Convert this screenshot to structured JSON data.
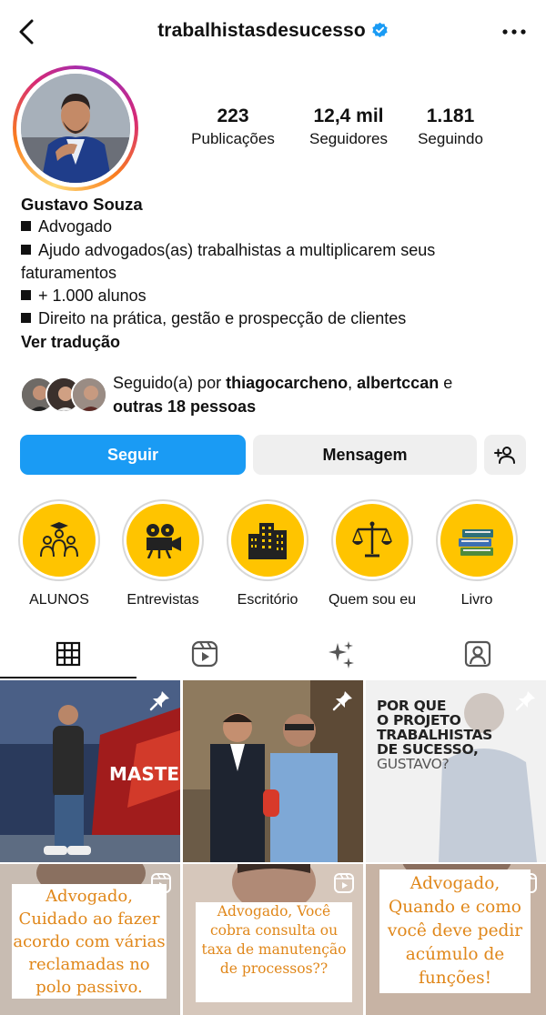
{
  "header": {
    "back_icon": "chevron-left-icon",
    "username": "trabalhistasdesucesso",
    "verified_icon": "verified-badge-icon",
    "more_icon": "more-horizontal-icon"
  },
  "stats": [
    {
      "value": "223",
      "label": "Publicações"
    },
    {
      "value": "12,4 mil",
      "label": "Seguidores"
    },
    {
      "value": "1.181",
      "label": "Seguindo"
    }
  ],
  "bio": {
    "name": "Gustavo Souza",
    "lines": [
      "Advogado",
      "Ajudo advogados(as) trabalhistas a multiplicarem seus faturamentos",
      "+ 1.000 alunos",
      "Direito na prática, gestão e prospecção de clientes"
    ],
    "translate": "Ver tradução"
  },
  "followed_by": {
    "prefix": "Seguido(a) por",
    "user1": "thiagocarcheno",
    "separator": ",",
    "user2": "albertccan",
    "conjunction": "e",
    "others": "outras 18 pessoas"
  },
  "actions": {
    "follow": "Seguir",
    "message": "Mensagem",
    "add_icon": "person-add-icon"
  },
  "highlights": [
    {
      "label": "ALUNOS",
      "icon": "graduates-icon"
    },
    {
      "label": "Entrevistas",
      "icon": "film-camera-icon"
    },
    {
      "label": "Escritório",
      "icon": "buildings-icon"
    },
    {
      "label": "Quem sou eu",
      "icon": "scales-icon"
    },
    {
      "label": "Livro",
      "icon": "books-icon"
    }
  ],
  "tabs": [
    "grid-icon",
    "reels-icon",
    "sparkles-icon",
    "tagged-icon"
  ],
  "posts": {
    "p1": {
      "banner": "MASTER MIND SA"
    },
    "p3": {
      "line1": "POR QUE",
      "line2": "O PROJETO",
      "line3": "TRABALHISTAS",
      "line4": "DE SUCESSO,",
      "line5": "GUSTAVO?"
    },
    "p4": {
      "text": "Advogado, Cuidado ao fazer acordo com várias reclamadas no polo passivo."
    },
    "p5": {
      "text": "Advogado, Você cobra consulta ou taxa de manutenção de processos??"
    },
    "p6": {
      "text": "Advogado, Quando e como você deve pedir acúmulo de funções!"
    }
  },
  "colors": {
    "accent_blue": "#1a9bf4",
    "highlight_yellow": "#ffc400",
    "post_text_orange": "#e0871a"
  }
}
